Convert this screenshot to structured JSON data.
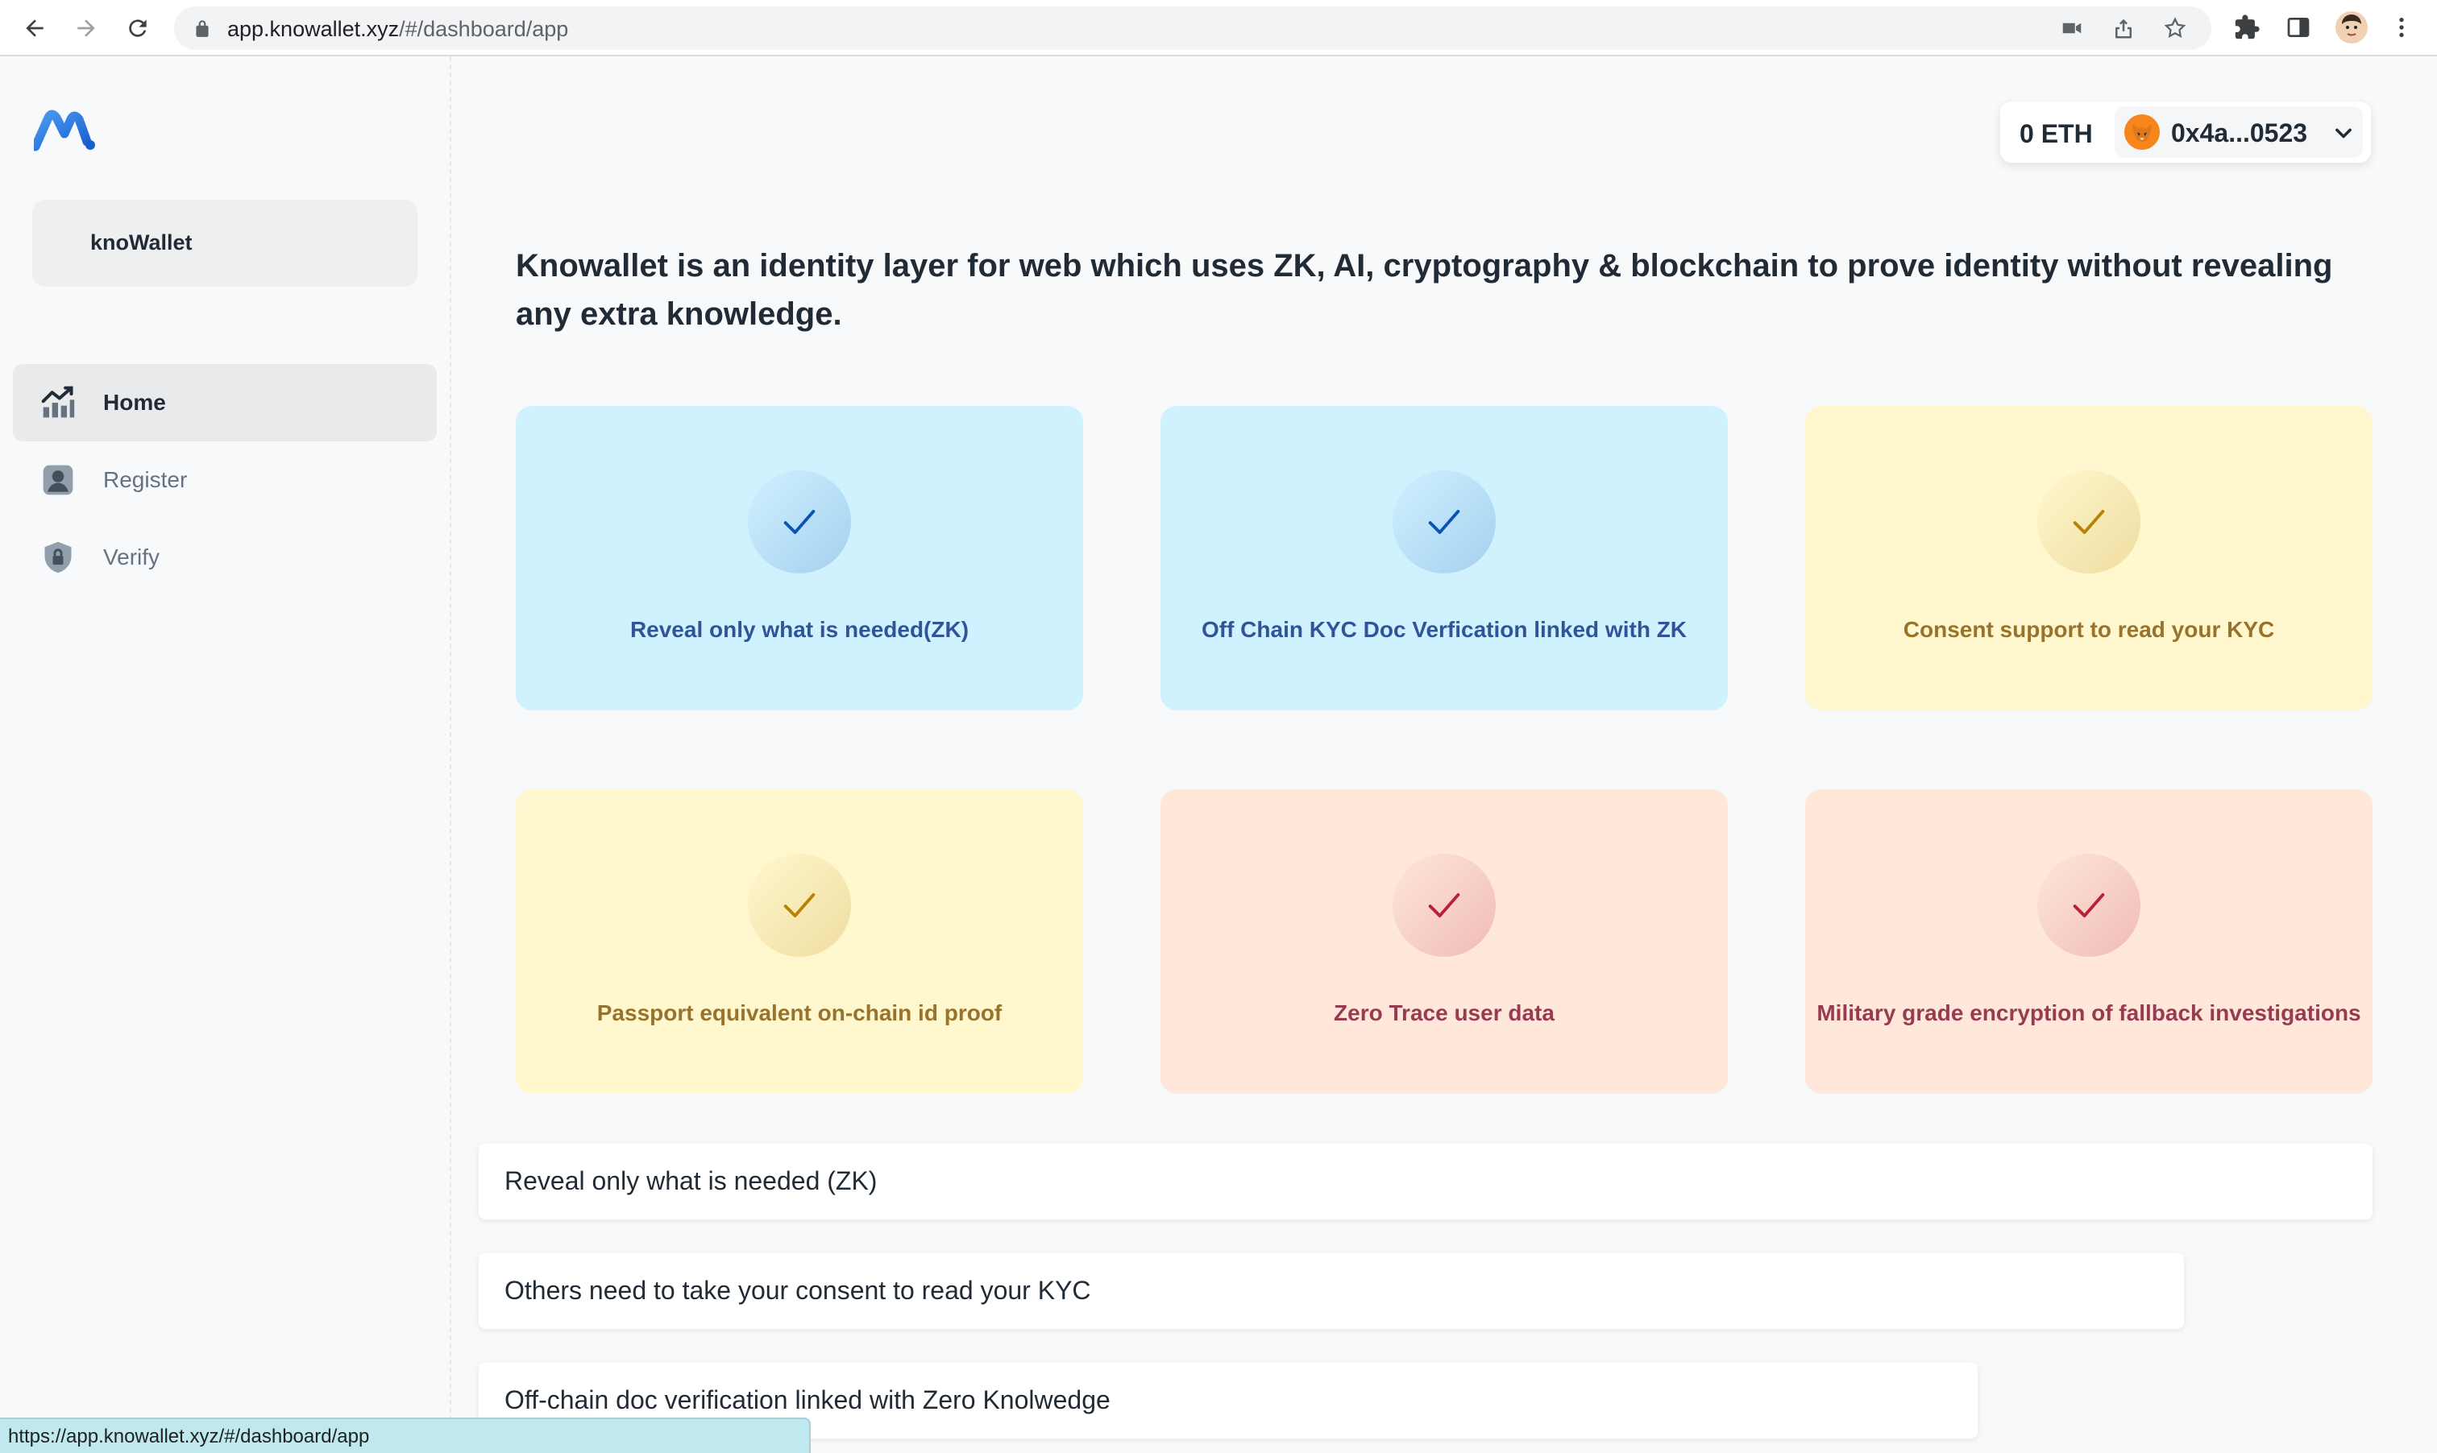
{
  "browser": {
    "url_host": "app.knowallet.xyz",
    "url_path": "/#/dashboard/app",
    "icons": [
      "back-icon",
      "forward-icon",
      "reload-icon",
      "lock-icon",
      "camera-off-icon",
      "share-icon",
      "bookmark-star-icon",
      "extensions-icon",
      "side-panel-icon",
      "profile-avatar",
      "more-menu-icon"
    ]
  },
  "sidebar": {
    "account_name": "knoWallet",
    "items": [
      {
        "label": "Home",
        "icon": "analytics-icon",
        "active": true
      },
      {
        "label": "Register",
        "icon": "user-icon",
        "active": false
      },
      {
        "label": "Verify",
        "icon": "shield-lock-icon",
        "active": false
      }
    ]
  },
  "wallet": {
    "balance": "0 ETH",
    "address": "0x4a...0523"
  },
  "intro": "Knowallet is an identity layer for web which uses ZK, AI, cryptography & blockchain to prove identity without revealing any extra knowledge.",
  "features": [
    {
      "label": "Reveal only what is needed(ZK)",
      "theme": "blue"
    },
    {
      "label": "Off Chain KYC Doc Verfication linked with ZK",
      "theme": "blue"
    },
    {
      "label": "Consent support to read your KYC",
      "theme": "yellow"
    },
    {
      "label": "Passport equivalent on-chain id proof",
      "theme": "yellow"
    },
    {
      "label": "Zero Trace user data",
      "theme": "red"
    },
    {
      "label": "Military grade encryption of fallback investigations",
      "theme": "red"
    }
  ],
  "info_bars": [
    "Reveal only what is needed (ZK)",
    "Others need to take your consent to read your KYC",
    "Off-chain doc verification linked with Zero Knolwedge"
  ],
  "status_url": "https://app.knowallet.xyz/#/dashboard/app",
  "colors": {
    "blue_card": "#d0f2ff",
    "yellow_card": "#fff7cd",
    "red_card": "#ffe7d9",
    "metamask": "#f6851b"
  }
}
